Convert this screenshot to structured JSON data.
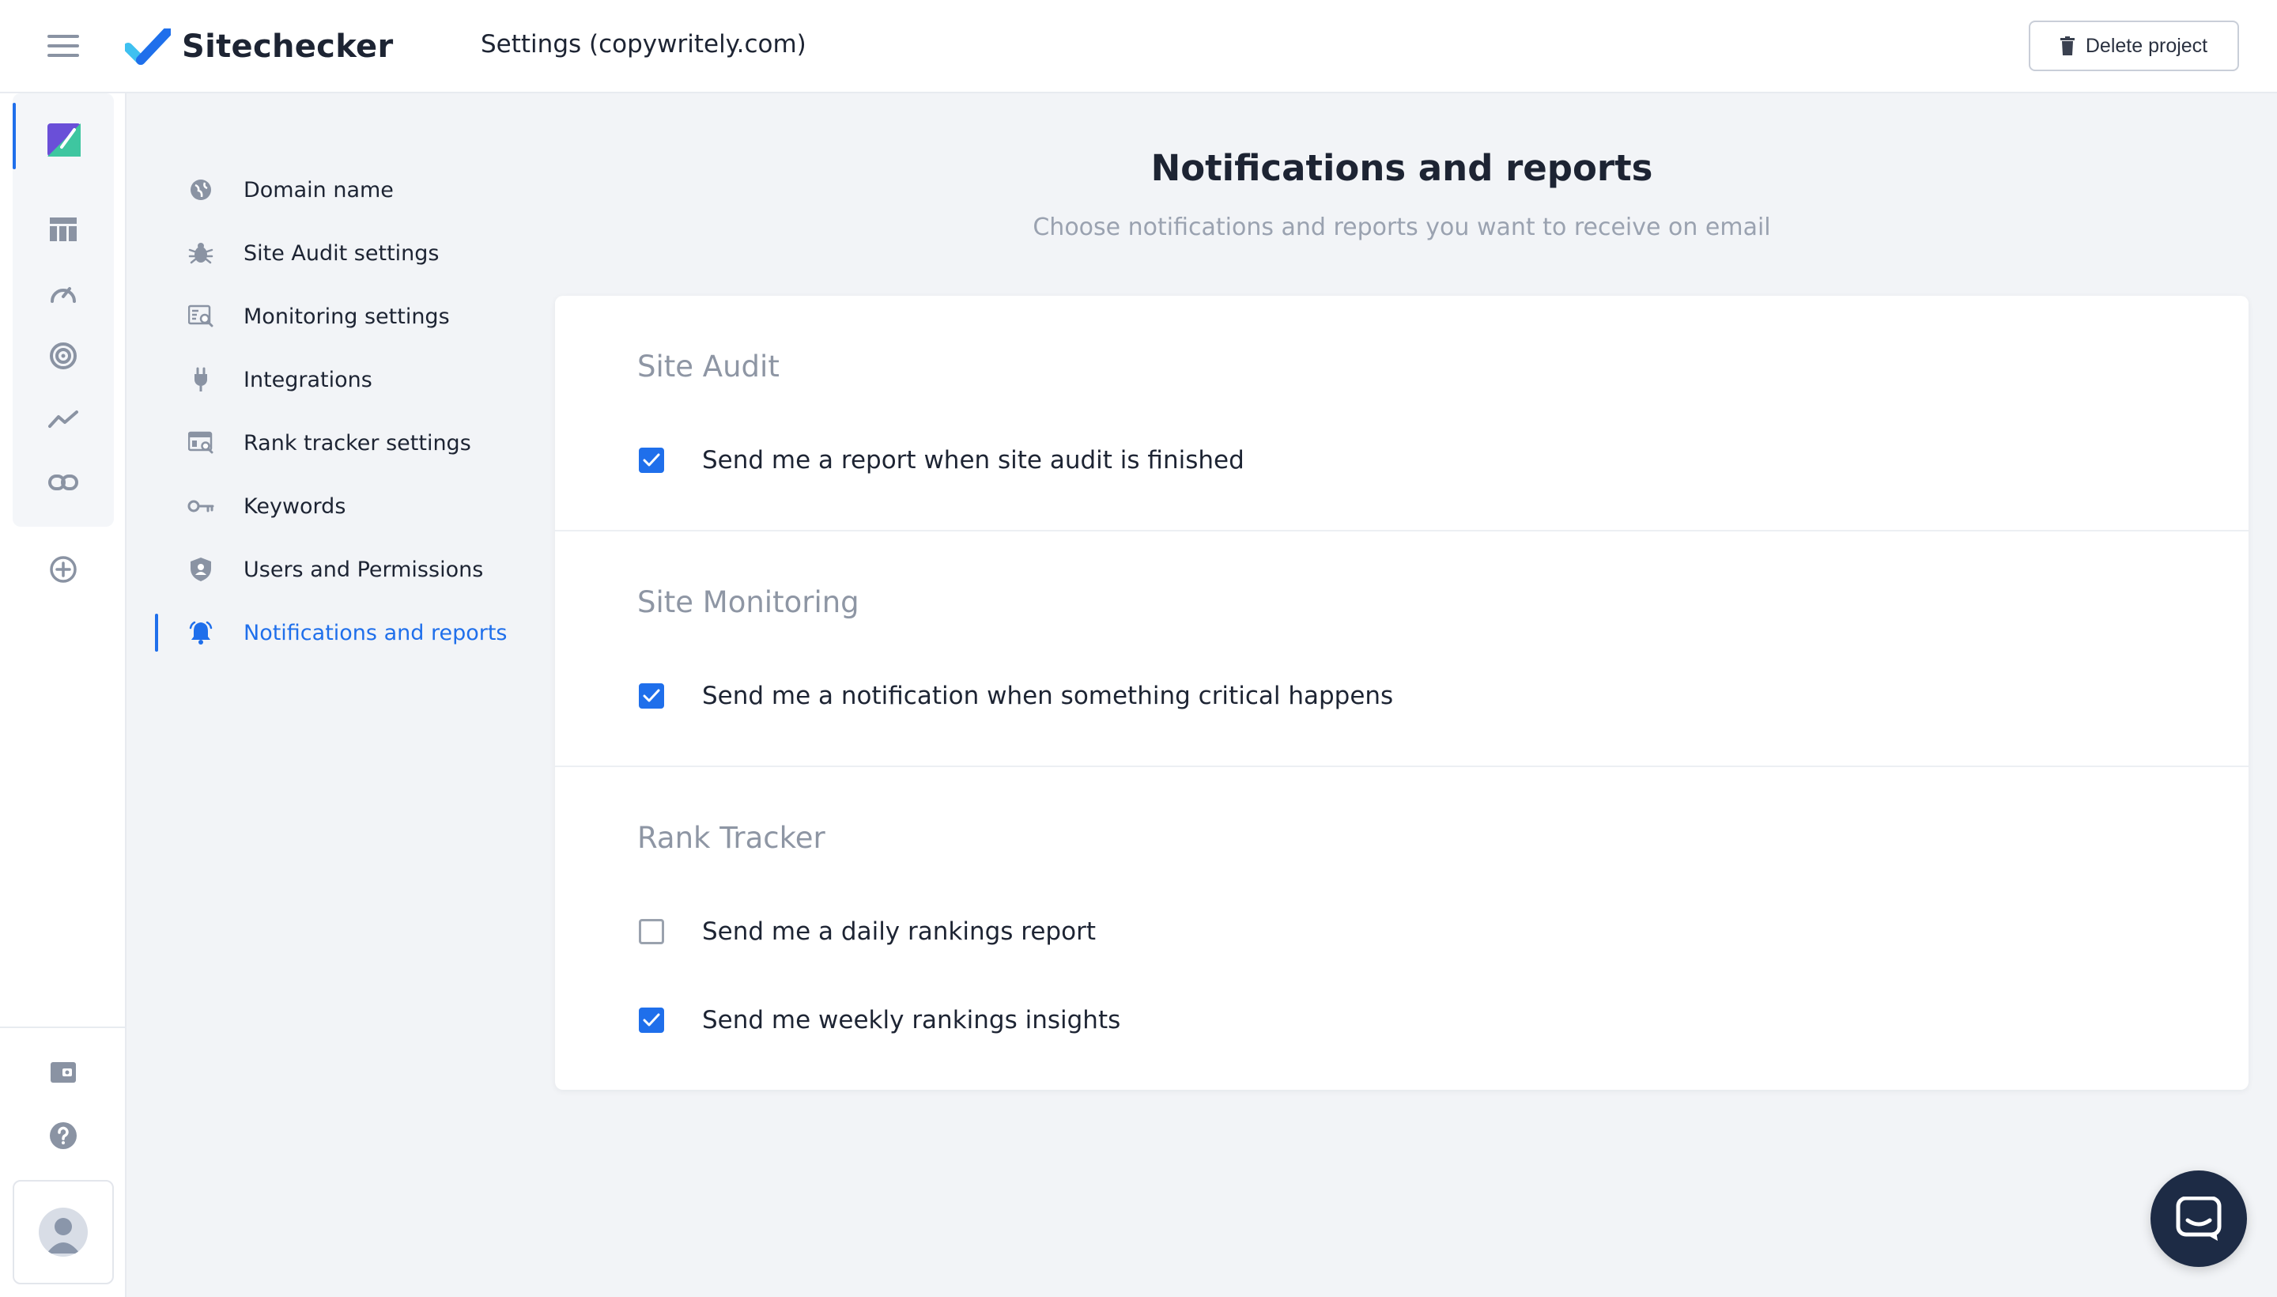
{
  "header": {
    "brand": "Sitechecker",
    "page_title": "Settings (copywritely.com)",
    "delete_label": "Delete project"
  },
  "settings_nav": {
    "items": [
      {
        "label": "Domain name",
        "icon": "globe-icon"
      },
      {
        "label": "Site Audit settings",
        "icon": "bug-icon"
      },
      {
        "label": "Monitoring settings",
        "icon": "monitor-search-icon"
      },
      {
        "label": "Integrations",
        "icon": "plug-icon"
      },
      {
        "label": "Rank tracker settings",
        "icon": "table-search-icon"
      },
      {
        "label": "Keywords",
        "icon": "key-icon"
      },
      {
        "label": "Users and Permissions",
        "icon": "shield-user-icon"
      },
      {
        "label": "Notifications and reports",
        "icon": "bell-icon",
        "active": true
      }
    ]
  },
  "main": {
    "title": "Notifications and reports",
    "subtitle": "Choose notifications and reports you want to receive on email",
    "sections": [
      {
        "title": "Site Audit",
        "options": [
          {
            "label": "Send me a report when site audit is finished",
            "checked": true
          }
        ]
      },
      {
        "title": "Site Monitoring",
        "options": [
          {
            "label": "Send me a notification when something critical happens",
            "checked": true
          }
        ]
      },
      {
        "title": "Rank Tracker",
        "options": [
          {
            "label": "Send me a daily rankings report",
            "checked": false
          },
          {
            "label": "Send me weekly rankings insights",
            "checked": true
          }
        ]
      }
    ]
  },
  "colors": {
    "accent": "#1f6feb",
    "chat_bubble": "#1d2b45",
    "background": "#f2f4f7"
  }
}
